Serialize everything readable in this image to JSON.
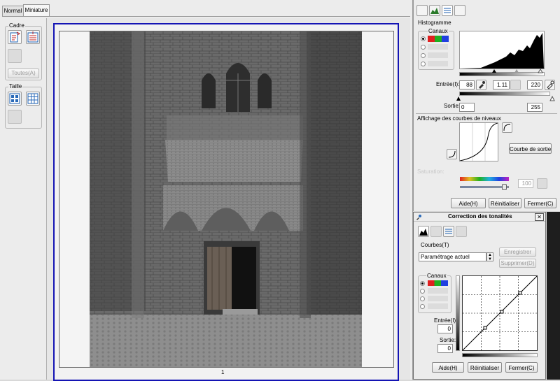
{
  "tabs": {
    "normal": "Normal",
    "miniature": "Miniature"
  },
  "left": {
    "cadre": "Cadre",
    "toutes": "Toutes(A)",
    "taille": "Taille"
  },
  "preview": {
    "page_number": "1"
  },
  "histogram_panel": {
    "section_title": "Histogramme",
    "canaux": "Canaux",
    "entree_label": "Entrée(I):",
    "entree_low": "88",
    "entree_gamma": "1.11",
    "entree_high": "220",
    "sortie_label": "Sortie:",
    "sortie_low": "0",
    "sortie_high": "255",
    "curves_title": "Affichage des courbes de niveaux",
    "courbe_sortie": "Courbe de sortie",
    "faded_label": "Saturation:",
    "saturation_value": "100",
    "aide": "Aide(H)",
    "reinitialiser": "Réinitialiser",
    "fermer": "Fermer(C)"
  },
  "tone_dialog": {
    "title": "Correction des tonalités",
    "close": "✕",
    "courbes": "Courbes(T)",
    "preset": "Paramétrage actuel",
    "enregistrer": "Enregistrer",
    "supprimer": "Supprimer(D)",
    "canaux": "Canaux",
    "entree_label": "Entrée(I):",
    "entree_value": "0",
    "sortie_label": "Sortie:",
    "sortie_value": "0",
    "aide": "Aide(H)",
    "reinitialiser": "Réinitialiser",
    "fermer": "Fermer(C)"
  },
  "colors": {
    "selection_border": "#1414b4",
    "panel_bg": "#ececec",
    "accent_red": "#e02020",
    "accent_green": "#20b020",
    "accent_blue": "#2040e0"
  }
}
